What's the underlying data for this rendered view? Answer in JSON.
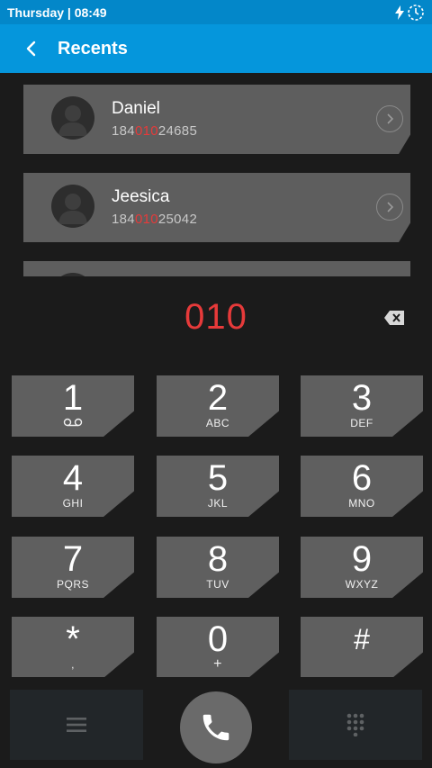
{
  "status_bar": {
    "time_text": "Thursday | 08:49",
    "icons": [
      "charging-icon",
      "sync-icon"
    ]
  },
  "app_bar": {
    "title": "Recents",
    "back_icon": "chevron-left-icon"
  },
  "recents": [
    {
      "name": "Daniel",
      "number_prefix": "184",
      "number_match": "010",
      "number_suffix": "24685"
    },
    {
      "name": "Jeesica",
      "number_prefix": "184",
      "number_match": "010",
      "number_suffix": "25042"
    }
  ],
  "dialer": {
    "entered_number": "010",
    "keys": [
      {
        "num": "1",
        "sub": ""
      },
      {
        "num": "2",
        "sub": "ABC"
      },
      {
        "num": "3",
        "sub": "DEF"
      },
      {
        "num": "4",
        "sub": "GHI"
      },
      {
        "num": "5",
        "sub": "JKL"
      },
      {
        "num": "6",
        "sub": "MNO"
      },
      {
        "num": "7",
        "sub": "PQRS"
      },
      {
        "num": "8",
        "sub": "TUV"
      },
      {
        "num": "9",
        "sub": "WXYZ"
      },
      {
        "num": "*",
        "sub": ","
      },
      {
        "num": "0",
        "sub": "+"
      },
      {
        "num": "#",
        "sub": ""
      }
    ]
  },
  "colors": {
    "status_bar": "#0387c9",
    "app_bar": "#0596dc",
    "highlight": "#e63a3a",
    "key": "#5f5f5f",
    "background": "#1b1b1b"
  }
}
